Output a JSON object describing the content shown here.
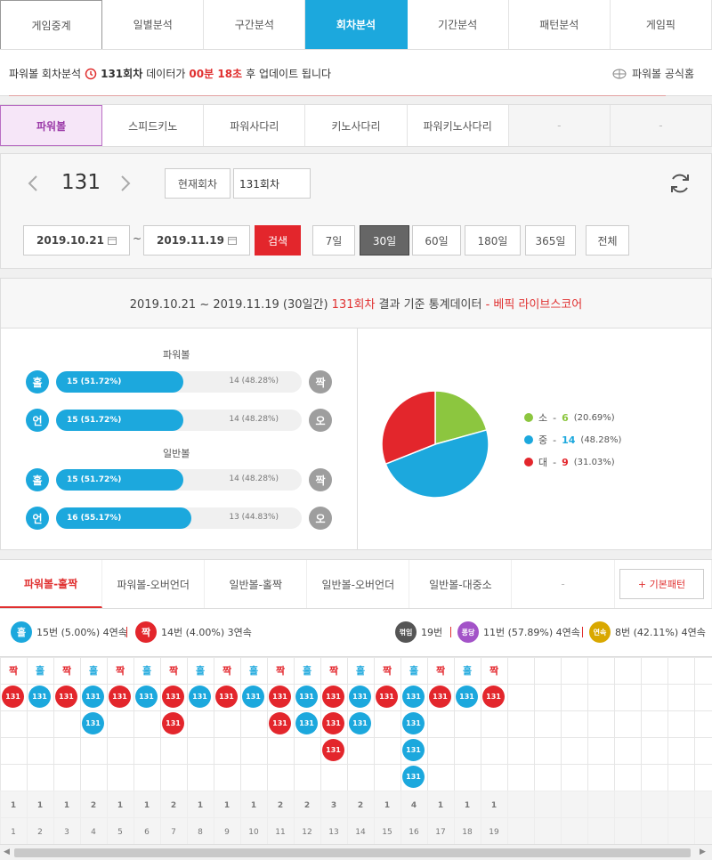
{
  "nav": {
    "tabs": [
      "게임중계",
      "일별분석",
      "구간분석",
      "회차분석",
      "기간분석",
      "패턴분석",
      "게임픽"
    ],
    "active": 3
  },
  "info": {
    "label": "파워볼 회차분석",
    "round": "131회차",
    "middle": "데이터가",
    "countdown": "00분 18초",
    "suffix": "후 업데이트 됩니다",
    "home_link": "파워볼 공식홈"
  },
  "games": {
    "items": [
      "파워볼",
      "스피드키노",
      "파워사다리",
      "키노사다리",
      "파워키노사다리",
      "-",
      "-"
    ]
  },
  "controls": {
    "round_number": "131",
    "current_label": "현재회차",
    "round_input": "131회차",
    "date_from": "2019.10.21",
    "date_to": "2019.11.19",
    "tilde": "~",
    "search_label": "검색",
    "periods": [
      "7일",
      "30일",
      "60일",
      "180일",
      "365일",
      "전체"
    ]
  },
  "stats": {
    "head_period": "2019.10.21 ~ 2019.11.19 (30일간)",
    "head_round": "131회차",
    "head_middle": "결과 기준 통계데이터",
    "head_source": "- 베픽 라이브스코어",
    "powerball_title": "파워볼",
    "normal_title": "일반볼",
    "powerball_rows": [
      {
        "left": "홀",
        "right": "짝",
        "left_text": "15 (51.72%)",
        "right_text": "14 (48.28%)",
        "ratio": 0.5172
      },
      {
        "left": "언",
        "right": "오",
        "left_text": "15 (51.72%)",
        "right_text": "14 (48.28%)",
        "ratio": 0.5172
      }
    ],
    "normal_rows": [
      {
        "left": "홀",
        "right": "짝",
        "left_text": "15 (51.72%)",
        "right_text": "14 (48.28%)",
        "ratio": 0.5172
      },
      {
        "left": "언",
        "right": "오",
        "left_text": "16 (55.17%)",
        "right_text": "13 (44.83%)",
        "ratio": 0.5517
      }
    ]
  },
  "chart_data": {
    "type": "pie",
    "slices": [
      {
        "label": "소",
        "count": "6",
        "pct": "(20.69%)",
        "value": 20.69,
        "color": "#8cc63f"
      },
      {
        "label": "중",
        "count": "14",
        "pct": "(48.28%)",
        "value": 48.28,
        "color": "#1ca8dd"
      },
      {
        "label": "대",
        "count": "9",
        "pct": "(31.03%)",
        "value": 31.03,
        "color": "#e3262c"
      }
    ]
  },
  "pattern_tabs": {
    "items": [
      "파워볼-홀짝",
      "파워볼-오버언더",
      "일반볼-홀짝",
      "일반볼-오버언더",
      "일반볼-대중소",
      "-"
    ],
    "basic_button": "+ 기본패턴"
  },
  "summary": {
    "odd": {
      "label": "홀",
      "text": "15번 (5.00%) 4연속"
    },
    "even": {
      "label": "짝",
      "text": "14번 (4.00%) 3연속"
    },
    "break": {
      "label": "꺾임",
      "text": "19번"
    },
    "pong": {
      "label": "퐁당",
      "text": "11번 (57.89%) 4연속"
    },
    "streak": {
      "label": "연속",
      "text": "8번 (42.11%) 4연속"
    }
  },
  "colors": {
    "odd": "#1ca8dd",
    "even": "#e3262c",
    "accent": "#1ca8dd"
  },
  "grid": {
    "ball_label": "131",
    "columns": [
      {
        "head": "짝",
        "type": "even",
        "count": 1,
        "index": "1"
      },
      {
        "head": "홀",
        "type": "odd",
        "count": 1,
        "index": "2"
      },
      {
        "head": "짝",
        "type": "even",
        "count": 1,
        "index": "3"
      },
      {
        "head": "홀",
        "type": "odd",
        "count": 2,
        "index": "4"
      },
      {
        "head": "짝",
        "type": "even",
        "count": 1,
        "index": "5"
      },
      {
        "head": "홀",
        "type": "odd",
        "count": 1,
        "index": "6"
      },
      {
        "head": "짝",
        "type": "even",
        "count": 2,
        "index": "7"
      },
      {
        "head": "홀",
        "type": "odd",
        "count": 1,
        "index": "8"
      },
      {
        "head": "짝",
        "type": "even",
        "count": 1,
        "index": "9"
      },
      {
        "head": "홀",
        "type": "odd",
        "count": 1,
        "index": "10"
      },
      {
        "head": "짝",
        "type": "even",
        "count": 2,
        "index": "11"
      },
      {
        "head": "홀",
        "type": "odd",
        "count": 2,
        "index": "12"
      },
      {
        "head": "짝",
        "type": "even",
        "count": 3,
        "index": "13"
      },
      {
        "head": "홀",
        "type": "odd",
        "count": 2,
        "index": "14"
      },
      {
        "head": "짝",
        "type": "even",
        "count": 1,
        "index": "15"
      },
      {
        "head": "홀",
        "type": "odd",
        "count": 4,
        "index": "16"
      },
      {
        "head": "짝",
        "type": "even",
        "count": 1,
        "index": "17"
      },
      {
        "head": "홀",
        "type": "odd",
        "count": 1,
        "index": "18"
      },
      {
        "head": "짝",
        "type": "even",
        "count": 1,
        "index": "19"
      }
    ]
  }
}
